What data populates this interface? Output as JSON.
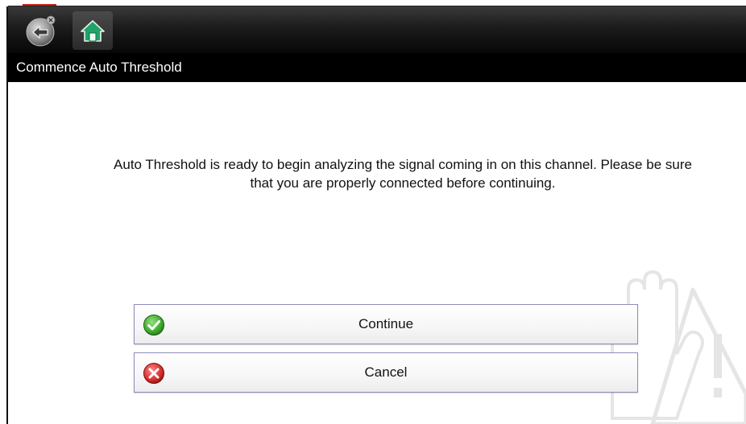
{
  "toolbar": {
    "back_icon": "back-arrow-icon",
    "home_icon": "home-icon"
  },
  "title": "Commence Auto Threshold",
  "message": "Auto Threshold is ready to begin analyzing the signal coming in on this channel. Please be sure that you are properly connected before continuing.",
  "buttons": [
    {
      "label": "Continue",
      "icon": "check-circle-icon",
      "color": "#3fa82c"
    },
    {
      "label": "Cancel",
      "icon": "x-circle-icon",
      "color": "#d42a2a"
    }
  ],
  "watermark_icon": "hand-warning-icon"
}
